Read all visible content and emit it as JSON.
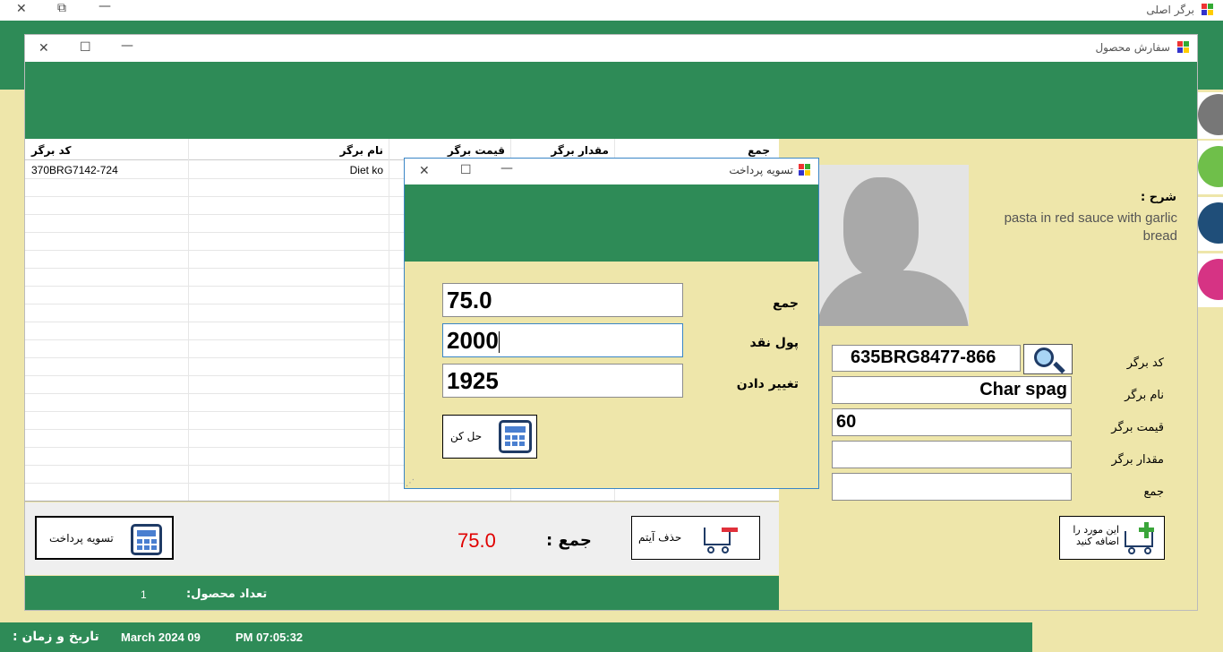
{
  "main_window": {
    "title": "برگر اصلی"
  },
  "order_window": {
    "title": "سفارش محصول",
    "table": {
      "columns": [
        "کد برگر",
        "نام برگر",
        "قیمت برگر",
        "مقدار برگر",
        "جمع"
      ],
      "rows": [
        {
          "code": "370BRG7142-724",
          "name": "Diet ko",
          "price": "",
          "qty": "",
          "total": ""
        }
      ]
    },
    "description_label": "شرح :",
    "description_value": "pasta in red sauce with garlic bread",
    "form": {
      "code_label": "کد برگر",
      "code_value": "635BRG8477-866",
      "name_label": "نام برگر",
      "name_value": "Char spag",
      "price_label": "قیمت برگر",
      "price_value": "60",
      "qty_label": "مقدار برگر",
      "qty_value": "",
      "total_label": "جمع",
      "total_value": ""
    },
    "add_button_label": "این مورد را اضافه کنید",
    "delete_button_label": "حذف آیتم",
    "pay_button_label": "تسویه پرداخت",
    "sum_label": "جمع :",
    "sum_value": "75.0",
    "count_label": "تعداد محصول:",
    "count_value": "1"
  },
  "payment_dialog": {
    "title": "تسویه پرداخت",
    "total_label": "جمع",
    "total_value": "75.0",
    "cash_label": "پول نقد",
    "cash_value": "2000",
    "change_label": "تغییر دادن",
    "change_value": "1925",
    "solve_button_label": "حل کن"
  },
  "status_bar": {
    "datetime_label": "تاریخ و زمان :",
    "date_value": "March 2024 09",
    "time_value": "PM 07:05:32"
  },
  "colors": {
    "accent_green": "#2e8b57",
    "panel_yellow": "#eee6aa",
    "sum_red": "#e00000"
  },
  "icons": [
    "close-icon",
    "maximize-icon",
    "minimize-icon",
    "restore-icon",
    "search-icon",
    "calculator-icon",
    "cart-add-icon",
    "cart-remove-icon",
    "avatar-icon"
  ]
}
